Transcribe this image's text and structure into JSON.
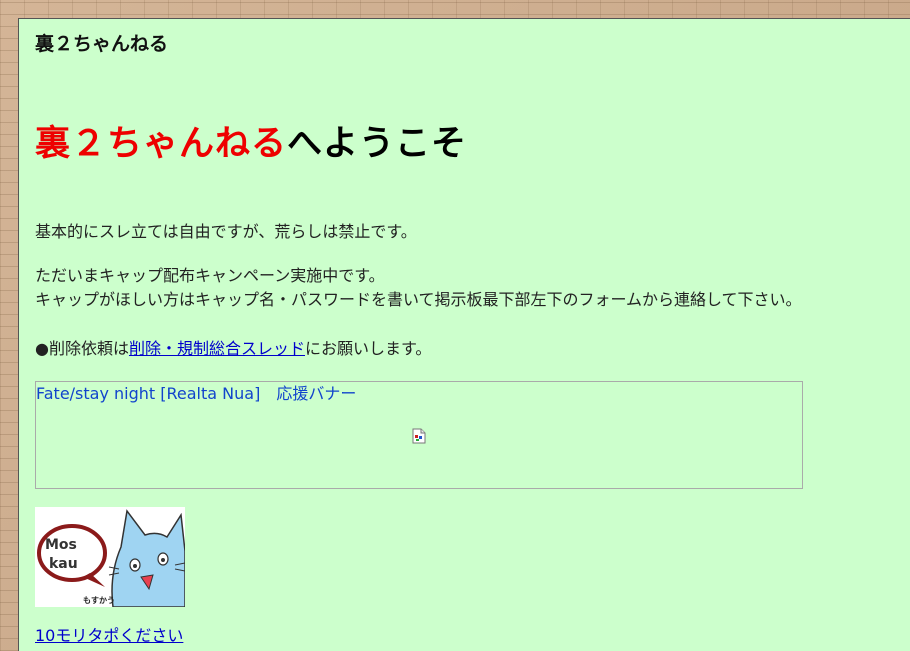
{
  "header": {
    "site_name": "裏２ちゃんねる"
  },
  "welcome": {
    "highlight": "裏２ちゃんねる",
    "rest": "へようこそ"
  },
  "notices": {
    "rule": "基本的にスレ立ては自由ですが、荒らしは禁止です。",
    "campaign_line1": "ただいまキャップ配布キャンペーン実施中です。",
    "campaign_line2": "キャップがほしい方はキャップ名・パスワードを書いて掲示板最下部左下のフォームから連絡して下さい。",
    "delete_prefix": "●削除依頼は",
    "delete_link": "削除・規制総合スレッド",
    "delete_suffix": "にお願いします。"
  },
  "banner": {
    "title": "Fate/stay night [Realta Nua]　応援バナー"
  },
  "moskau_image": {
    "bubble_line1": "Mos",
    "bubble_line2": "kau",
    "caption": "もすかう"
  },
  "footer": {
    "link": "10モリタポください"
  },
  "colors": {
    "board_background": "#ccffcc",
    "highlight_red": "#ee0000",
    "link_blue": "#0000cc"
  }
}
